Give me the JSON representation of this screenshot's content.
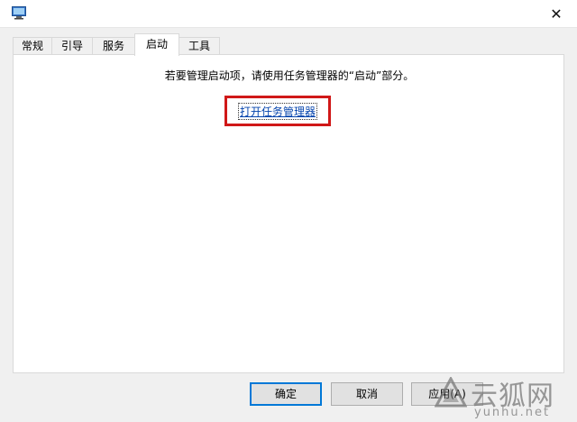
{
  "window": {
    "icon": "system-configuration-icon",
    "close_glyph": "✕"
  },
  "tabs": [
    {
      "label": "常规",
      "active": false
    },
    {
      "label": "引导",
      "active": false
    },
    {
      "label": "服务",
      "active": false
    },
    {
      "label": "启动",
      "active": true
    },
    {
      "label": "工具",
      "active": false
    }
  ],
  "startup": {
    "message": "若要管理启动项，请使用任务管理器的“启动”部分。",
    "link_label": "打开任务管理器"
  },
  "buttons": {
    "ok": "确定",
    "cancel": "取消",
    "apply": "应用(A)"
  },
  "watermark": {
    "name": "云狐网",
    "site": "yunhu.net"
  },
  "colors": {
    "highlight_box": "#d01818",
    "link": "#0645ad",
    "default_button_border": "#0078d7"
  }
}
